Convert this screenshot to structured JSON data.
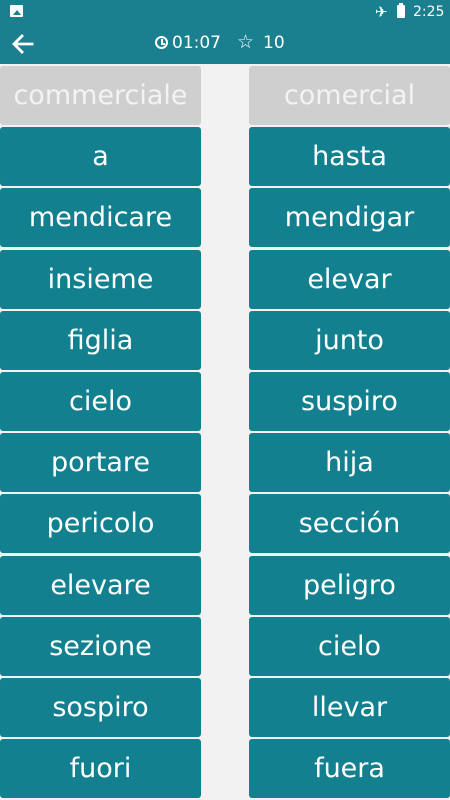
{
  "status_bar": {
    "time": "2:25",
    "icons": [
      "image-icon",
      "airplane-icon",
      "battery-icon"
    ]
  },
  "app_bar": {
    "timer": "01:07",
    "score": "10"
  },
  "colors": {
    "primary": "#12808f",
    "header": "#1a7f8e",
    "matched": "#cfcfcf",
    "background": "#f2f2f2"
  },
  "left_words": [
    "commerciale",
    "a",
    "mendicare",
    "insieme",
    "figlia",
    "cielo",
    "portare",
    "pericolo",
    "elevare",
    "sezione",
    "sospiro",
    "fuori"
  ],
  "right_words": [
    "comercial",
    "hasta",
    "mendigar",
    "elevar",
    "junto",
    "suspiro",
    "hija",
    "sección",
    "peligro",
    "cielo",
    "llevar",
    "fuera"
  ],
  "matched_index": 0
}
